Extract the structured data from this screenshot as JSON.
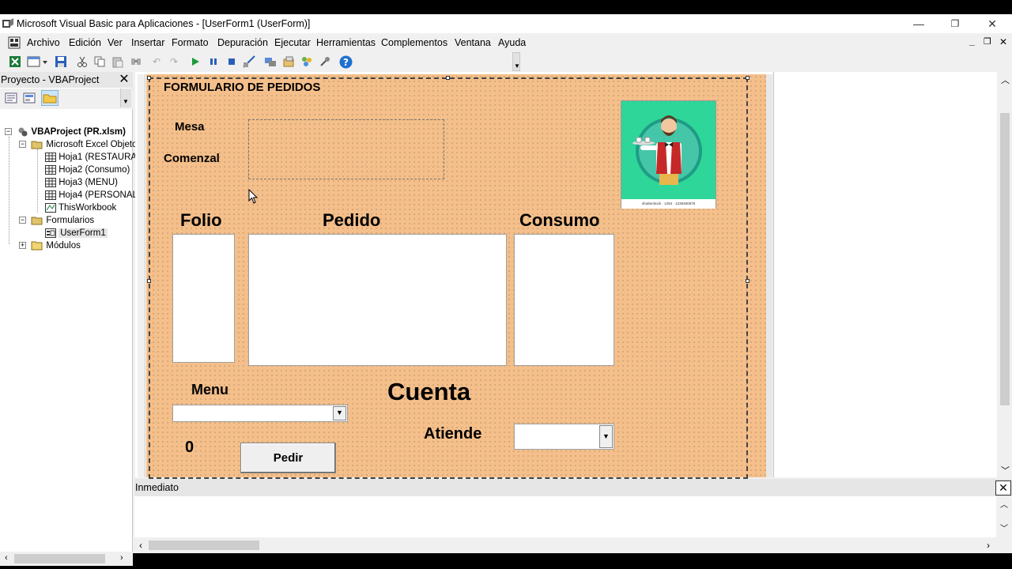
{
  "window": {
    "title": "Microsoft Visual Basic para Aplicaciones - [UserForm1 (UserForm)]",
    "minimize": "—",
    "restore": "❐",
    "close": "✕"
  },
  "menu": {
    "items": [
      "Archivo",
      "Edición",
      "Ver",
      "Insertar",
      "Formato",
      "Depuración",
      "Ejecutar",
      "Herramientas",
      "Complementos",
      "Ventana",
      "Ayuda"
    ],
    "child_min": "_",
    "child_restore": "❐",
    "child_close": "✕"
  },
  "project": {
    "title": "Proyecto - VBAProject",
    "close": "✕",
    "tree": {
      "root": "VBAProject (PR.xlsm)",
      "excel_objects": "Microsoft Excel Objeto",
      "sheets": [
        "Hoja1 (RESTAURA",
        "Hoja2 (Consumo)",
        "Hoja3 (MENU)",
        "Hoja4 (PERSONAL",
        "ThisWorkbook"
      ],
      "forms_folder": "Formularios",
      "form": "UserForm1",
      "modules_folder": "Módulos"
    }
  },
  "userform": {
    "frame_title": "FORMULARIO DE PEDIDOS",
    "mesa_label": "Mesa",
    "comenzal_label": "Comenzal",
    "folio_label": "Folio",
    "pedido_label": "Pedido",
    "consumo_label": "Consumo",
    "menu_label": "Menu",
    "cuenta_label": "Cuenta",
    "atiende_label": "Atiende",
    "counter_value": "0",
    "pedir_button": "Pedir",
    "image_caption": "shutterstock · 1294 · 1236490878"
  },
  "immediate": {
    "title": "Inmediato",
    "close": "✕"
  },
  "colors": {
    "form_bg": "#f4bf8a",
    "image_bg": "#2ed69a",
    "accent": "#1e6fd0"
  }
}
